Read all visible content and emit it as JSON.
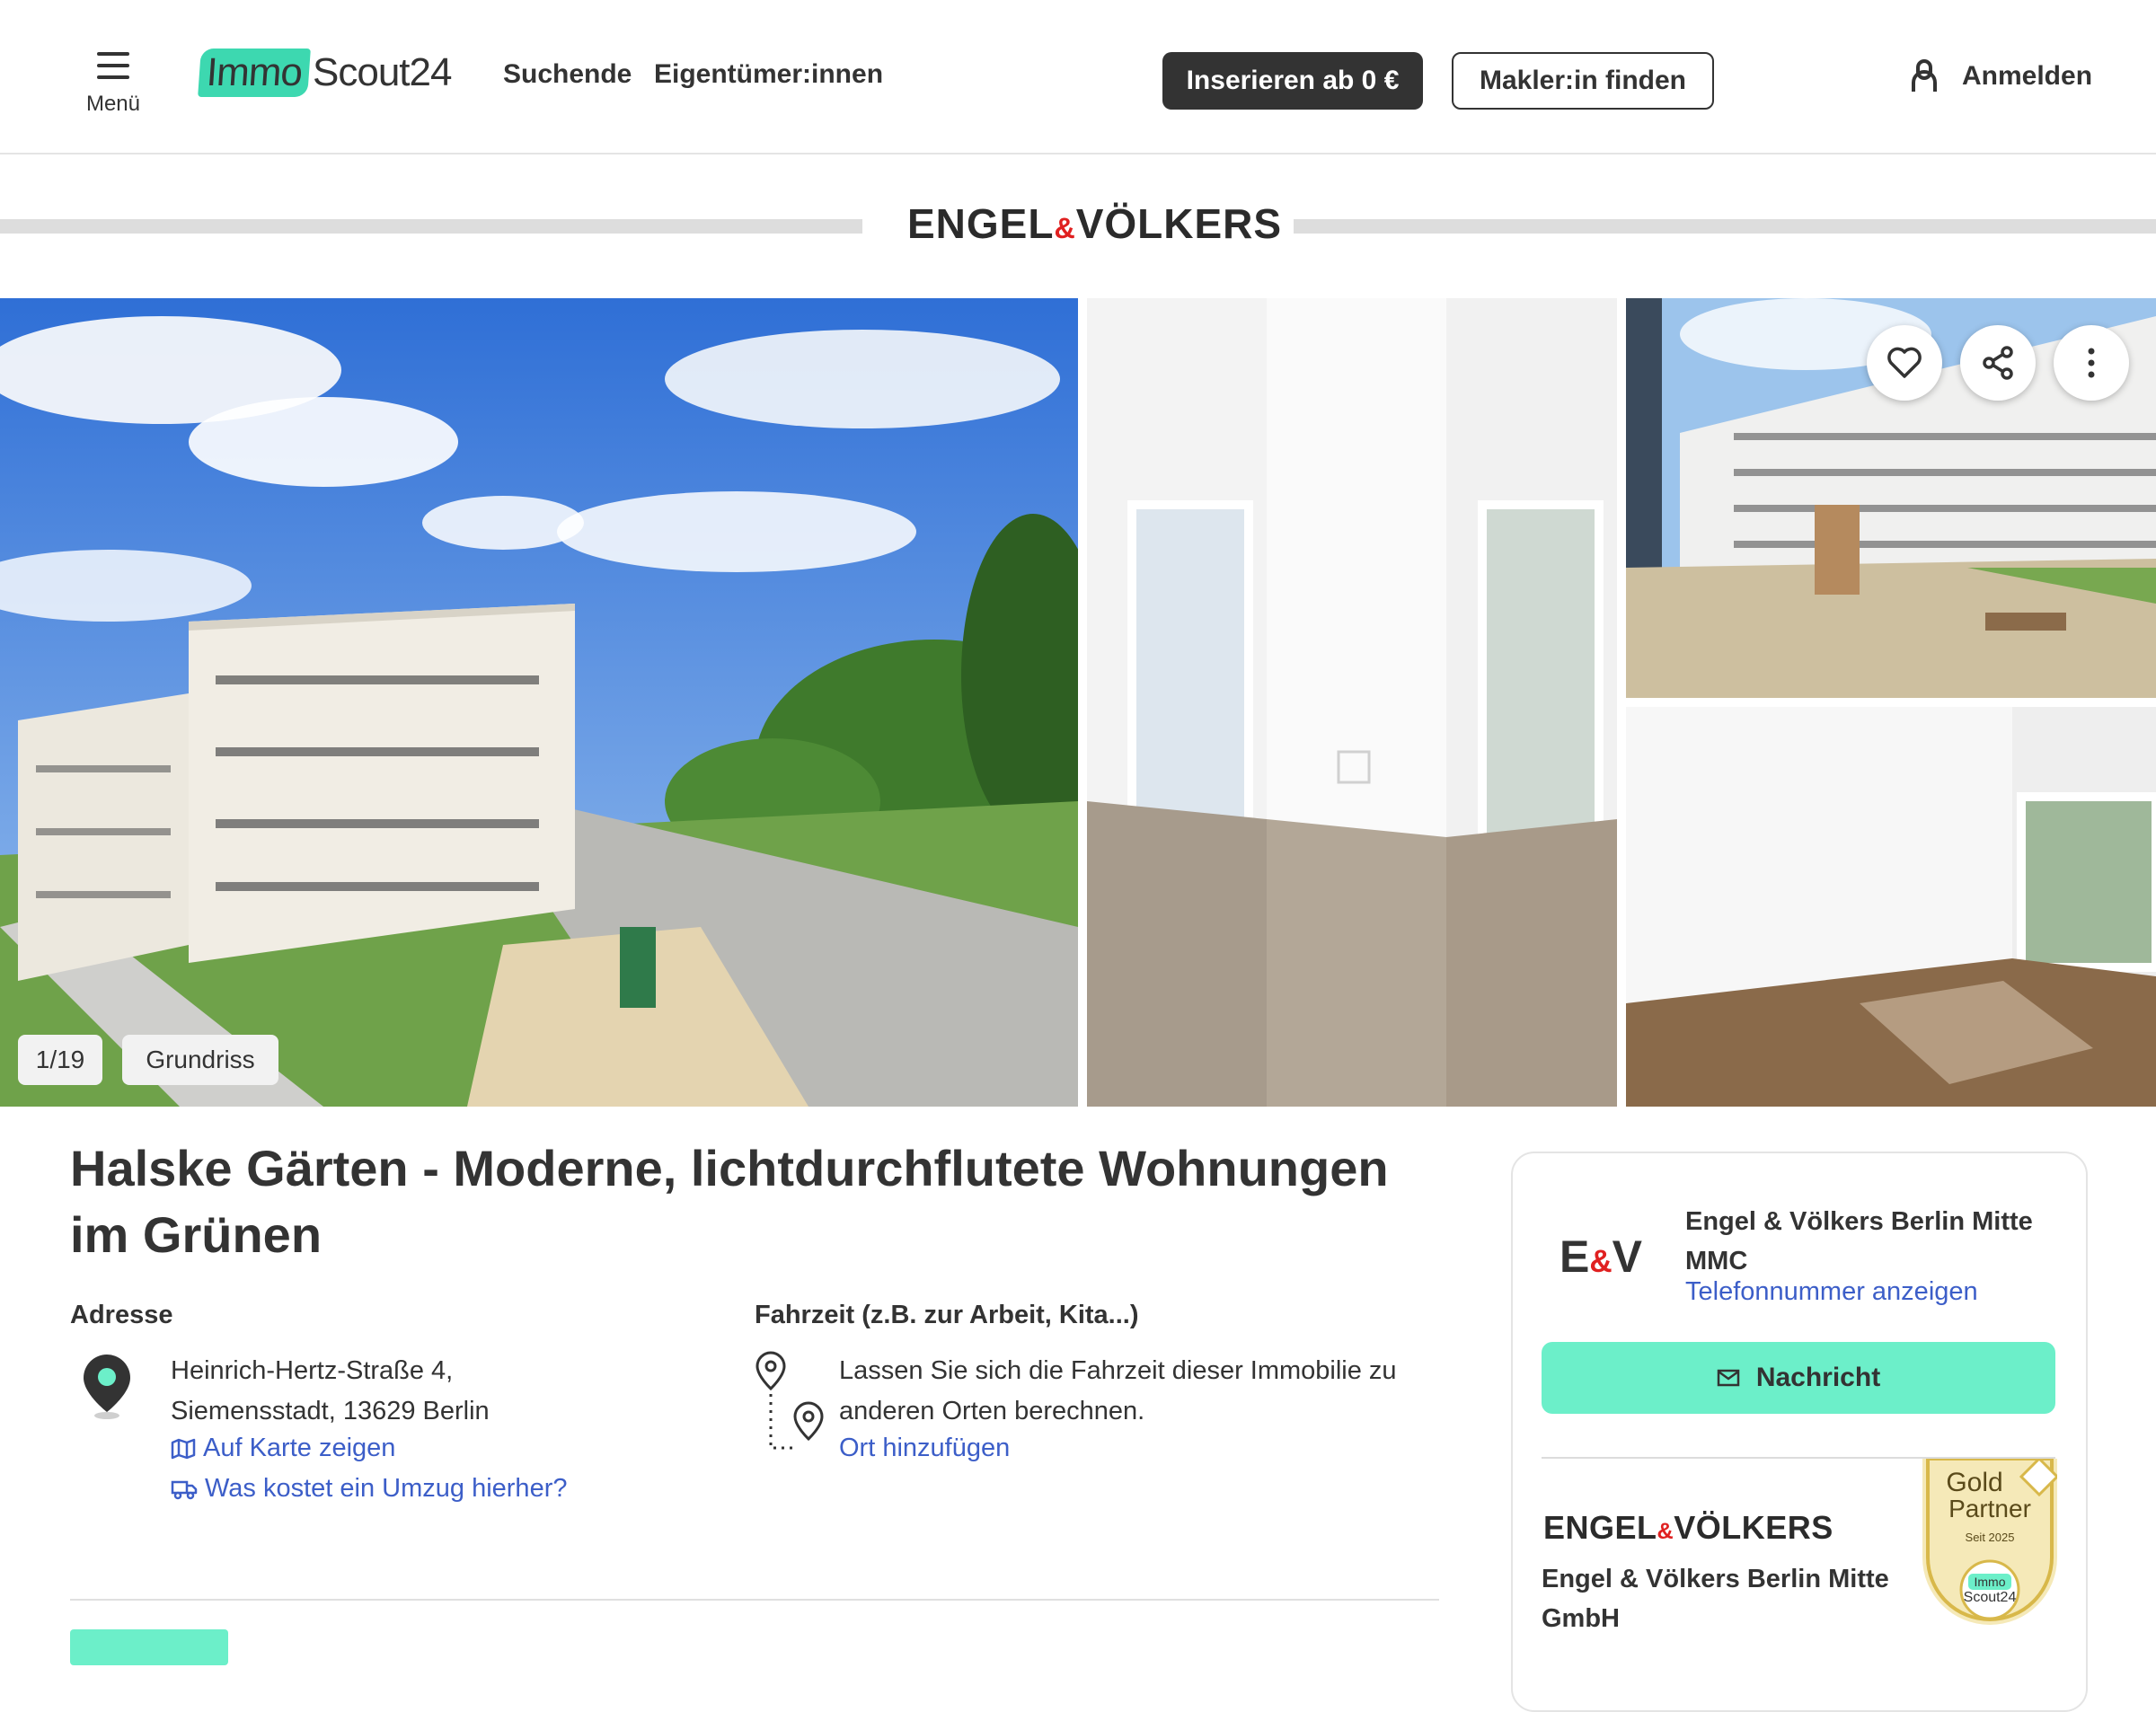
{
  "header": {
    "menu_label": "Menü",
    "logo": {
      "immo": "Immo",
      "scout": "Scout24"
    },
    "nav": [
      "Suchende",
      "Eigentümer:innen"
    ],
    "cta_primary": "Inserieren ab 0 €",
    "cta_secondary": "Makler:in finden",
    "login_label": "Anmelden"
  },
  "brand": {
    "name_left": "ENGEL",
    "amp": "&",
    "name_right": "VÖLKERS"
  },
  "gallery": {
    "counter": "1/19",
    "floorplan_label": "Grundriss",
    "actions": [
      "heart-icon",
      "share-icon",
      "more-icon"
    ]
  },
  "listing": {
    "title": "Halske Gärten - Moderne, lichtdurchflutete Wohnungen im Grünen",
    "address_label": "Adresse",
    "address_line1": "Heinrich-Hertz-Straße 4,",
    "address_line2": "Siemensstadt, 13629 Berlin",
    "map_link": "Auf Karte zeigen",
    "move_link": "Was kostet ein Umzug hierher?",
    "travel_label": "Fahrzeit (z.B. zur Arbeit, Kita...)",
    "travel_text": "Lassen Sie sich die Fahrzeit dieser Immobilie zu anderen Orten berechnen.",
    "travel_link": "Ort hinzufügen"
  },
  "contact": {
    "logo_e": "E",
    "logo_amp": "&",
    "logo_v": "V",
    "agent_name": "Engel & Völkers Berlin Mitte MMC",
    "phone_link": "Telefonnummer anzeigen",
    "message_button": "Nachricht",
    "company_logo_left": "ENGEL",
    "company_logo_amp": "&",
    "company_logo_right": "VÖLKERS",
    "company_name": "Engel & Völkers Berlin Mitte GmbH",
    "badge": {
      "title": "Gold",
      "subtitle": "Partner",
      "since": "Seit 2025",
      "immo": "Immo",
      "scout": "Scout24"
    }
  },
  "colors": {
    "accent": "#6cefc9",
    "logo_green": "#3dd8b0",
    "link": "#3c5ec8",
    "text": "#333333",
    "brand_red": "#e02020"
  }
}
